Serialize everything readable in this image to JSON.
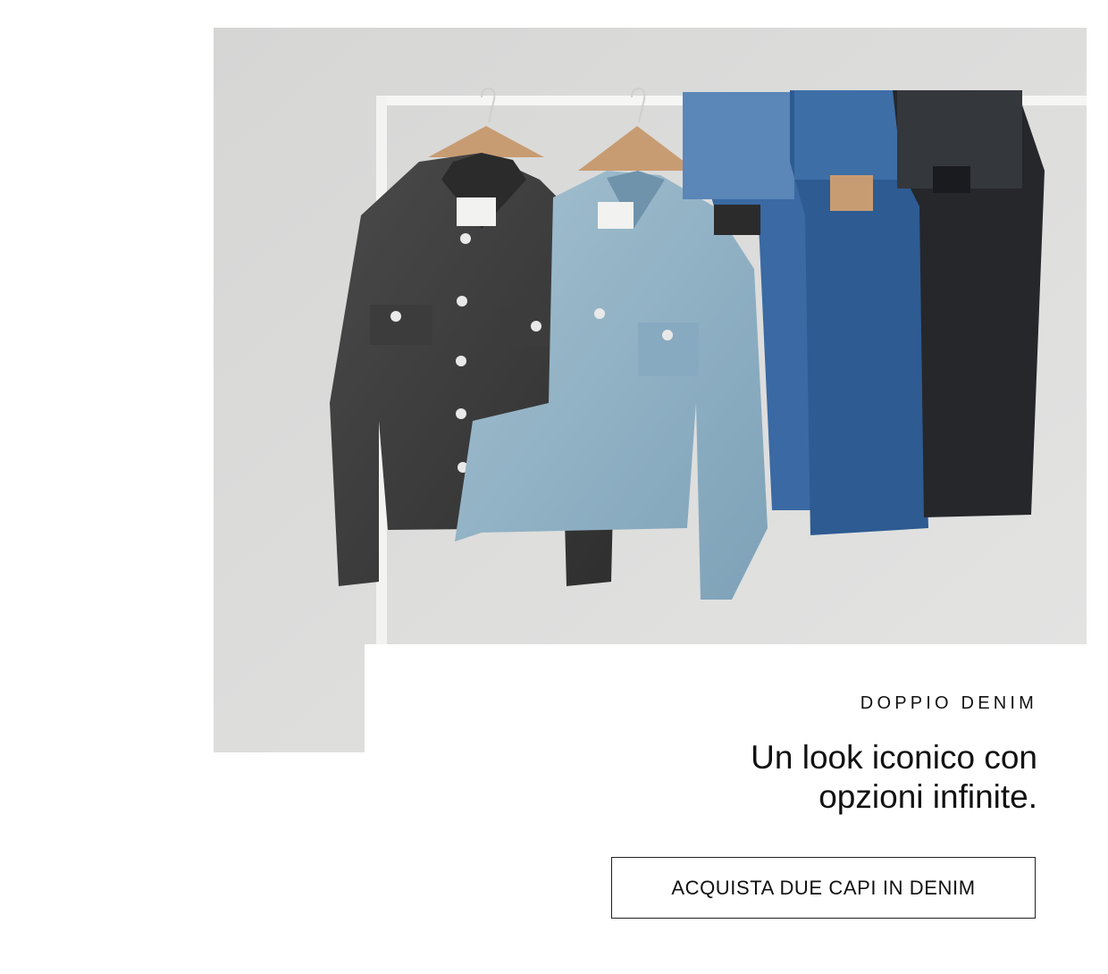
{
  "hero": {
    "eyebrow": "DOPPIO DENIM",
    "headline_line1": "Un look iconico con",
    "headline_line2": "opzioni infinite.",
    "cta_label": "ACQUISTA DUE CAPI IN DENIM"
  },
  "colors": {
    "backdrop": "#dcdcdb",
    "rack": "#f6f6f4",
    "black_denim": "#3a3a3a",
    "light_denim": "#8fb0c3",
    "mid_denim": "#3d6ea6",
    "dark_denim": "#2a4f86",
    "black_jeans": "#25272b",
    "text": "#111111"
  },
  "icons": [
    "clothing-rack-icon",
    "hanger-icon"
  ]
}
